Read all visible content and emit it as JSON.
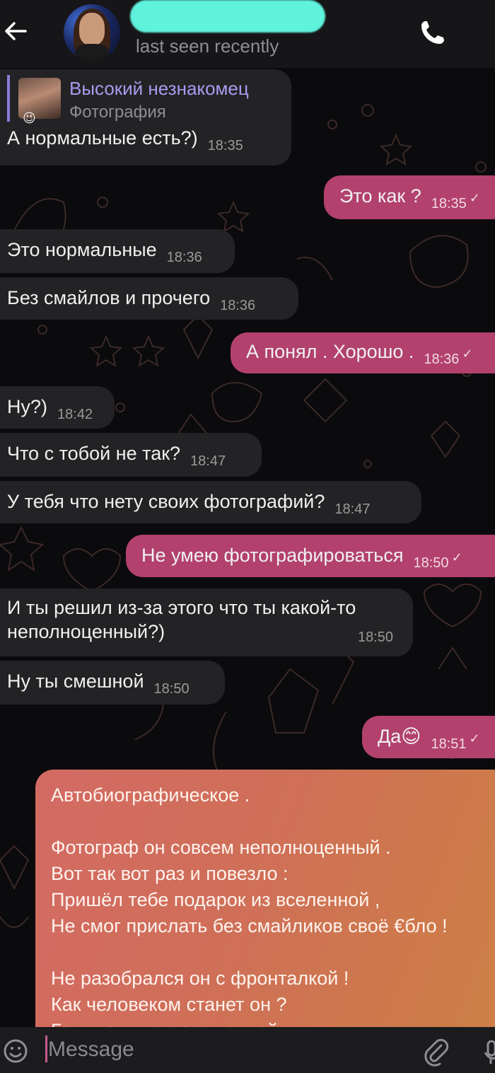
{
  "header": {
    "last_seen": "last seen recently",
    "back_icon": "arrow-left-icon",
    "call_icon": "phone-icon"
  },
  "messages": [
    {
      "dir": "in",
      "reply": {
        "title": "Высокий незнакомец",
        "subtitle": "Фотография"
      },
      "text": "А нормальные есть?)",
      "time": "18:35"
    },
    {
      "dir": "out",
      "text": "Это как ?",
      "time": "18:35"
    },
    {
      "dir": "in",
      "text": "Это нормальные",
      "time": "18:36"
    },
    {
      "dir": "in",
      "text": "Без смайлов и прочего",
      "time": "18:36"
    },
    {
      "dir": "out",
      "text": "А понял . Хорошо .",
      "time": "18:36"
    },
    {
      "dir": "in",
      "text": "Ну?)",
      "time": "18:42"
    },
    {
      "dir": "in",
      "text": "Что с тобой не так?",
      "time": "18:47"
    },
    {
      "dir": "in",
      "text": "У тебя что нету своих фотографий?",
      "time": "18:47"
    },
    {
      "dir": "out",
      "text": "Не умею фотографироваться",
      "time": "18:50"
    },
    {
      "dir": "in",
      "text_line1": "И ты решил из-за этого что ты какой-то",
      "text_line2": "неполноценный?)",
      "time": "18:50"
    },
    {
      "dir": "in",
      "text": "Ну ты смешной",
      "time": "18:50"
    },
    {
      "dir": "out",
      "text": "Да😊",
      "time": "18:51"
    }
  ],
  "poem": {
    "title": "Автобиографическое .",
    "stanza1": "Фотограф он совсем неполноценный .\nВот так вот раз и повезло :\nПришёл тебе подарок из вселенной ,\nНе смог прислать без смайликов своё €бло !",
    "stanza2": "Не разобрался он с фронталкой !\nКак человеком станет он ?\nГони таких скорее палкой ."
  },
  "composer": {
    "placeholder": "Message",
    "emoji_icon": "smiley-icon",
    "attach_icon": "paperclip-icon",
    "mic_icon": "microphone-icon"
  },
  "colors": {
    "incoming_bubble": "#232225",
    "outgoing_bubble": "#b2416e",
    "poem_gradient_start": "#d36a63",
    "poem_gradient_end": "#cd7f45",
    "reply_accent": "#8d7bd9",
    "background": "#0b0a0c"
  }
}
